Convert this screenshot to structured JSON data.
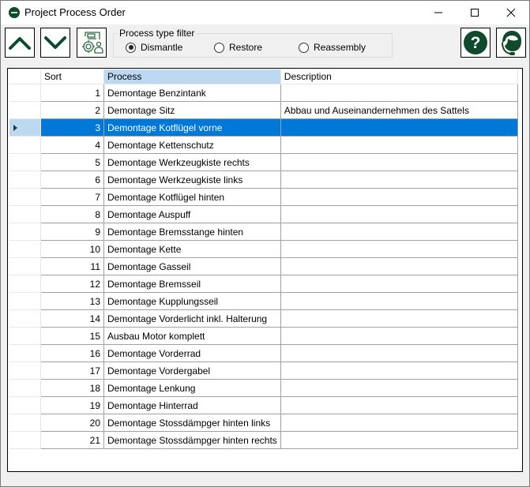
{
  "window": {
    "title": "Project Process Order"
  },
  "titlebar": {
    "minimize": "minimize-icon",
    "maximize": "maximize-icon",
    "close": "close-icon"
  },
  "toolbar": {
    "move_up_icon": "chevron-up-icon",
    "move_down_icon": "chevron-down-icon",
    "settings_icon": "process-settings-icon",
    "help_icon": "help-icon",
    "support_icon": "support-headset-icon",
    "accent_color": "#0f4a2c"
  },
  "filter": {
    "label": "Process type filter",
    "options": [
      {
        "label": "Dismantle",
        "checked": true
      },
      {
        "label": "Restore",
        "checked": false
      },
      {
        "label": "Reassembly",
        "checked": false
      }
    ]
  },
  "grid": {
    "columns": [
      "Sort",
      "Process",
      "Description"
    ],
    "selected_index": 2,
    "selection_color": "#0078d7",
    "rows": [
      {
        "sort": "1",
        "process": "Demontage Benzintank",
        "description": ""
      },
      {
        "sort": "2",
        "process": "Demontage Sitz",
        "description": "Abbau und Auseinandernehmen des Sattels"
      },
      {
        "sort": "3",
        "process": "Demontage Kotflügel vorne",
        "description": ""
      },
      {
        "sort": "4",
        "process": "Demontage Kettenschutz",
        "description": ""
      },
      {
        "sort": "5",
        "process": "Demontage Werkzeugkiste rechts",
        "description": ""
      },
      {
        "sort": "6",
        "process": "Demontage Werkzeugkiste links",
        "description": ""
      },
      {
        "sort": "7",
        "process": "Demontage Kotflügel hinten",
        "description": ""
      },
      {
        "sort": "8",
        "process": "Demontage Auspuff",
        "description": ""
      },
      {
        "sort": "9",
        "process": "Demontage Bremsstange hinten",
        "description": ""
      },
      {
        "sort": "10",
        "process": "Demontage Kette",
        "description": ""
      },
      {
        "sort": "11",
        "process": "Demontage Gasseil",
        "description": ""
      },
      {
        "sort": "12",
        "process": "Demontage Bremsseil",
        "description": ""
      },
      {
        "sort": "13",
        "process": "Demontage Kupplungsseil",
        "description": ""
      },
      {
        "sort": "14",
        "process": "Demontage Vorderlicht inkl. Halterung",
        "description": ""
      },
      {
        "sort": "15",
        "process": "Ausbau Motor komplett",
        "description": ""
      },
      {
        "sort": "16",
        "process": "Demontage Vorderrad",
        "description": ""
      },
      {
        "sort": "17",
        "process": "Demontage Vordergabel",
        "description": ""
      },
      {
        "sort": "18",
        "process": "Demontage Lenkung",
        "description": ""
      },
      {
        "sort": "19",
        "process": "Demontage Hinterrad",
        "description": ""
      },
      {
        "sort": "20",
        "process": "Demontage Stossdämpger hinten links",
        "description": ""
      },
      {
        "sort": "21",
        "process": "Demontage Stossdämpger hinten rechts",
        "description": ""
      }
    ]
  }
}
